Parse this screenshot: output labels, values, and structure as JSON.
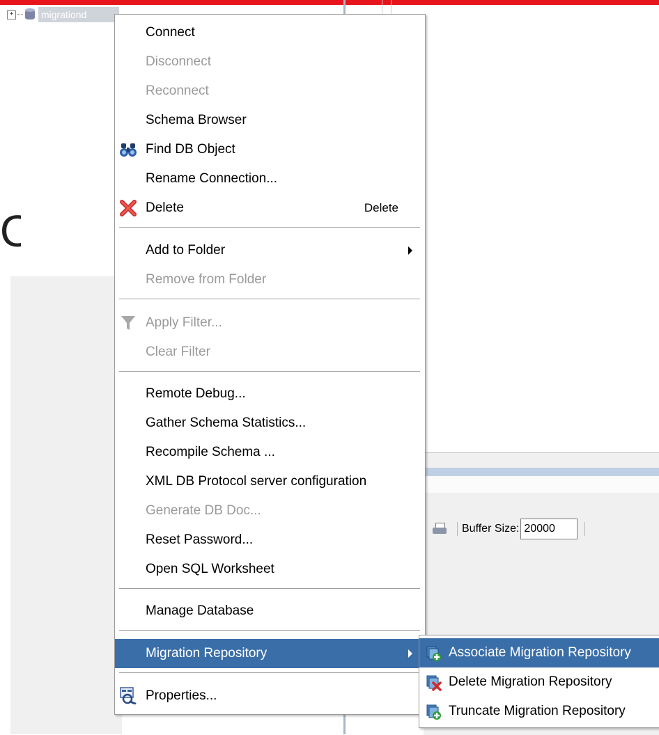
{
  "tree": {
    "expand_glyph": "+",
    "connection_label": "migrationd",
    "connection_icon": "database-icon"
  },
  "background": {
    "partial_letter": "O"
  },
  "toolbar": {
    "print_icon": "printer-icon",
    "buffer_label": "Buffer Size:",
    "buffer_value": "20000"
  },
  "menu": {
    "items": [
      {
        "label": "Connect",
        "enabled": true
      },
      {
        "label": "Disconnect",
        "enabled": false
      },
      {
        "label": "Reconnect",
        "enabled": false
      },
      {
        "label": "Schema Browser",
        "enabled": true
      },
      {
        "label": "Find DB Object",
        "enabled": true,
        "icon": "binoculars-icon"
      },
      {
        "label": "Rename Connection...",
        "enabled": true
      },
      {
        "label": "Delete",
        "enabled": true,
        "icon": "red-x-icon",
        "shortcut": "Delete"
      },
      {
        "label": "Add to Folder",
        "enabled": true,
        "submenu": true
      },
      {
        "label": "Remove from Folder",
        "enabled": false
      },
      {
        "label": "Apply Filter...",
        "enabled": false,
        "icon": "funnel-icon"
      },
      {
        "label": "Clear Filter",
        "enabled": false
      },
      {
        "label": "Remote Debug...",
        "enabled": true
      },
      {
        "label": "Gather Schema Statistics...",
        "enabled": true
      },
      {
        "label": "Recompile Schema ...",
        "enabled": true
      },
      {
        "label": "XML DB Protocol server configuration",
        "enabled": true
      },
      {
        "label": "Generate DB Doc...",
        "enabled": false
      },
      {
        "label": "Reset Password...",
        "enabled": true
      },
      {
        "label": "Open SQL Worksheet",
        "enabled": true
      },
      {
        "label": "Manage Database",
        "enabled": true
      },
      {
        "label": "Migration Repository",
        "enabled": true,
        "submenu": true,
        "selected": true
      },
      {
        "label": "Properties...",
        "enabled": true,
        "icon": "properties-icon"
      }
    ]
  },
  "submenu": {
    "items": [
      {
        "label": "Associate Migration Repository",
        "icon": "associate-repository-icon",
        "selected": true
      },
      {
        "label": "Delete Migration Repository",
        "icon": "delete-repository-icon"
      },
      {
        "label": "Truncate Migration Repository",
        "icon": "truncate-repository-icon"
      }
    ]
  },
  "colors": {
    "selection": "#3a6ea8",
    "disabled_text": "#9a9a9a",
    "top_bar": "#e8141b"
  }
}
